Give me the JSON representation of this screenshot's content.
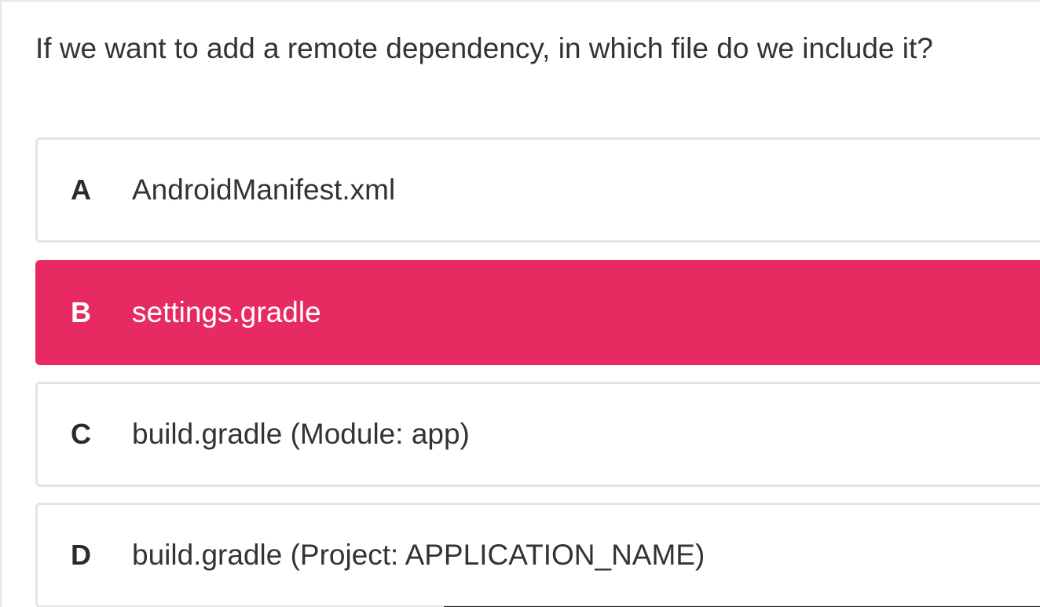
{
  "quiz": {
    "question": "If we want to add a remote dependency, in which file do we include it?",
    "options": [
      {
        "letter": "A",
        "text": "AndroidManifest.xml",
        "selected": false
      },
      {
        "letter": "B",
        "text": "settings.gradle",
        "selected": true
      },
      {
        "letter": "C",
        "text": "build.gradle (Module: app)",
        "selected": false
      },
      {
        "letter": "D",
        "text": "build.gradle (Project: APPLICATION_NAME)",
        "selected": false
      }
    ]
  },
  "colors": {
    "selected_background": "#e82a63",
    "option_border": "#e4e4e4",
    "text": "#333333"
  }
}
